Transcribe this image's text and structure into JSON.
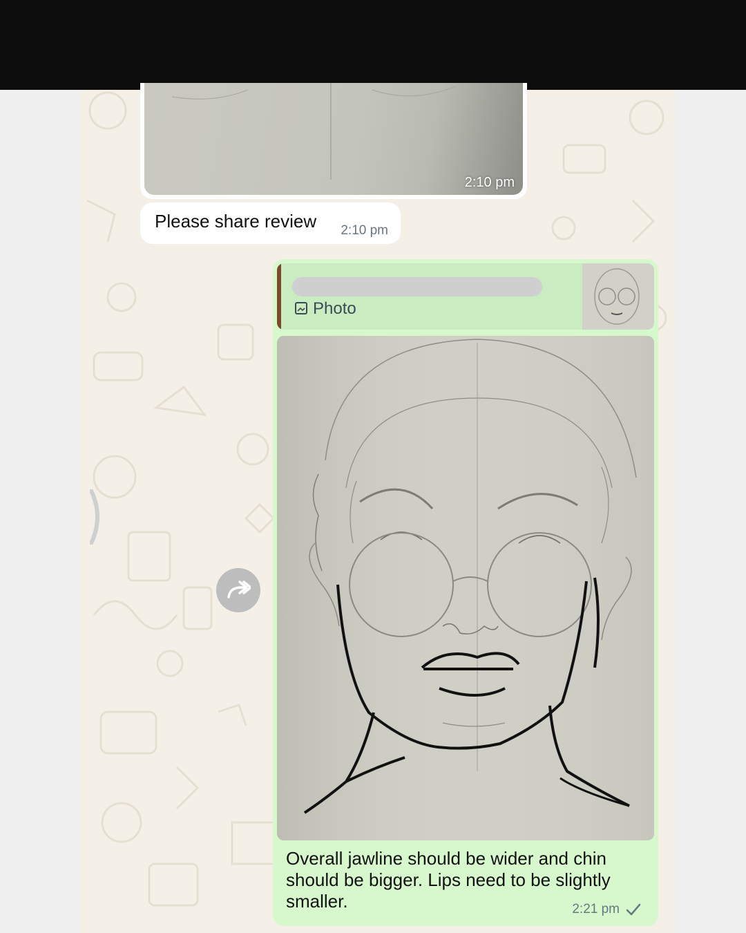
{
  "chat": {
    "incoming_image": {
      "time": "2:10 pm"
    },
    "incoming_text": {
      "text": "Please share review",
      "time": "2:10 pm"
    },
    "outgoing": {
      "quote": {
        "label": "Photo",
        "icon": "photo-icon"
      },
      "caption": "Overall jawline should be wider and chin should be bigger. Lips need to be slightly smaller.",
      "time": "2:21 pm",
      "status_icon": "sent-check-icon"
    },
    "forward_icon": "forward-icon"
  },
  "colors": {
    "outgoing_bubble": "#d6f8cc",
    "incoming_bubble": "#ffffff",
    "chat_background": "#f4f0e8",
    "top_bar": "#0d0d0d"
  }
}
